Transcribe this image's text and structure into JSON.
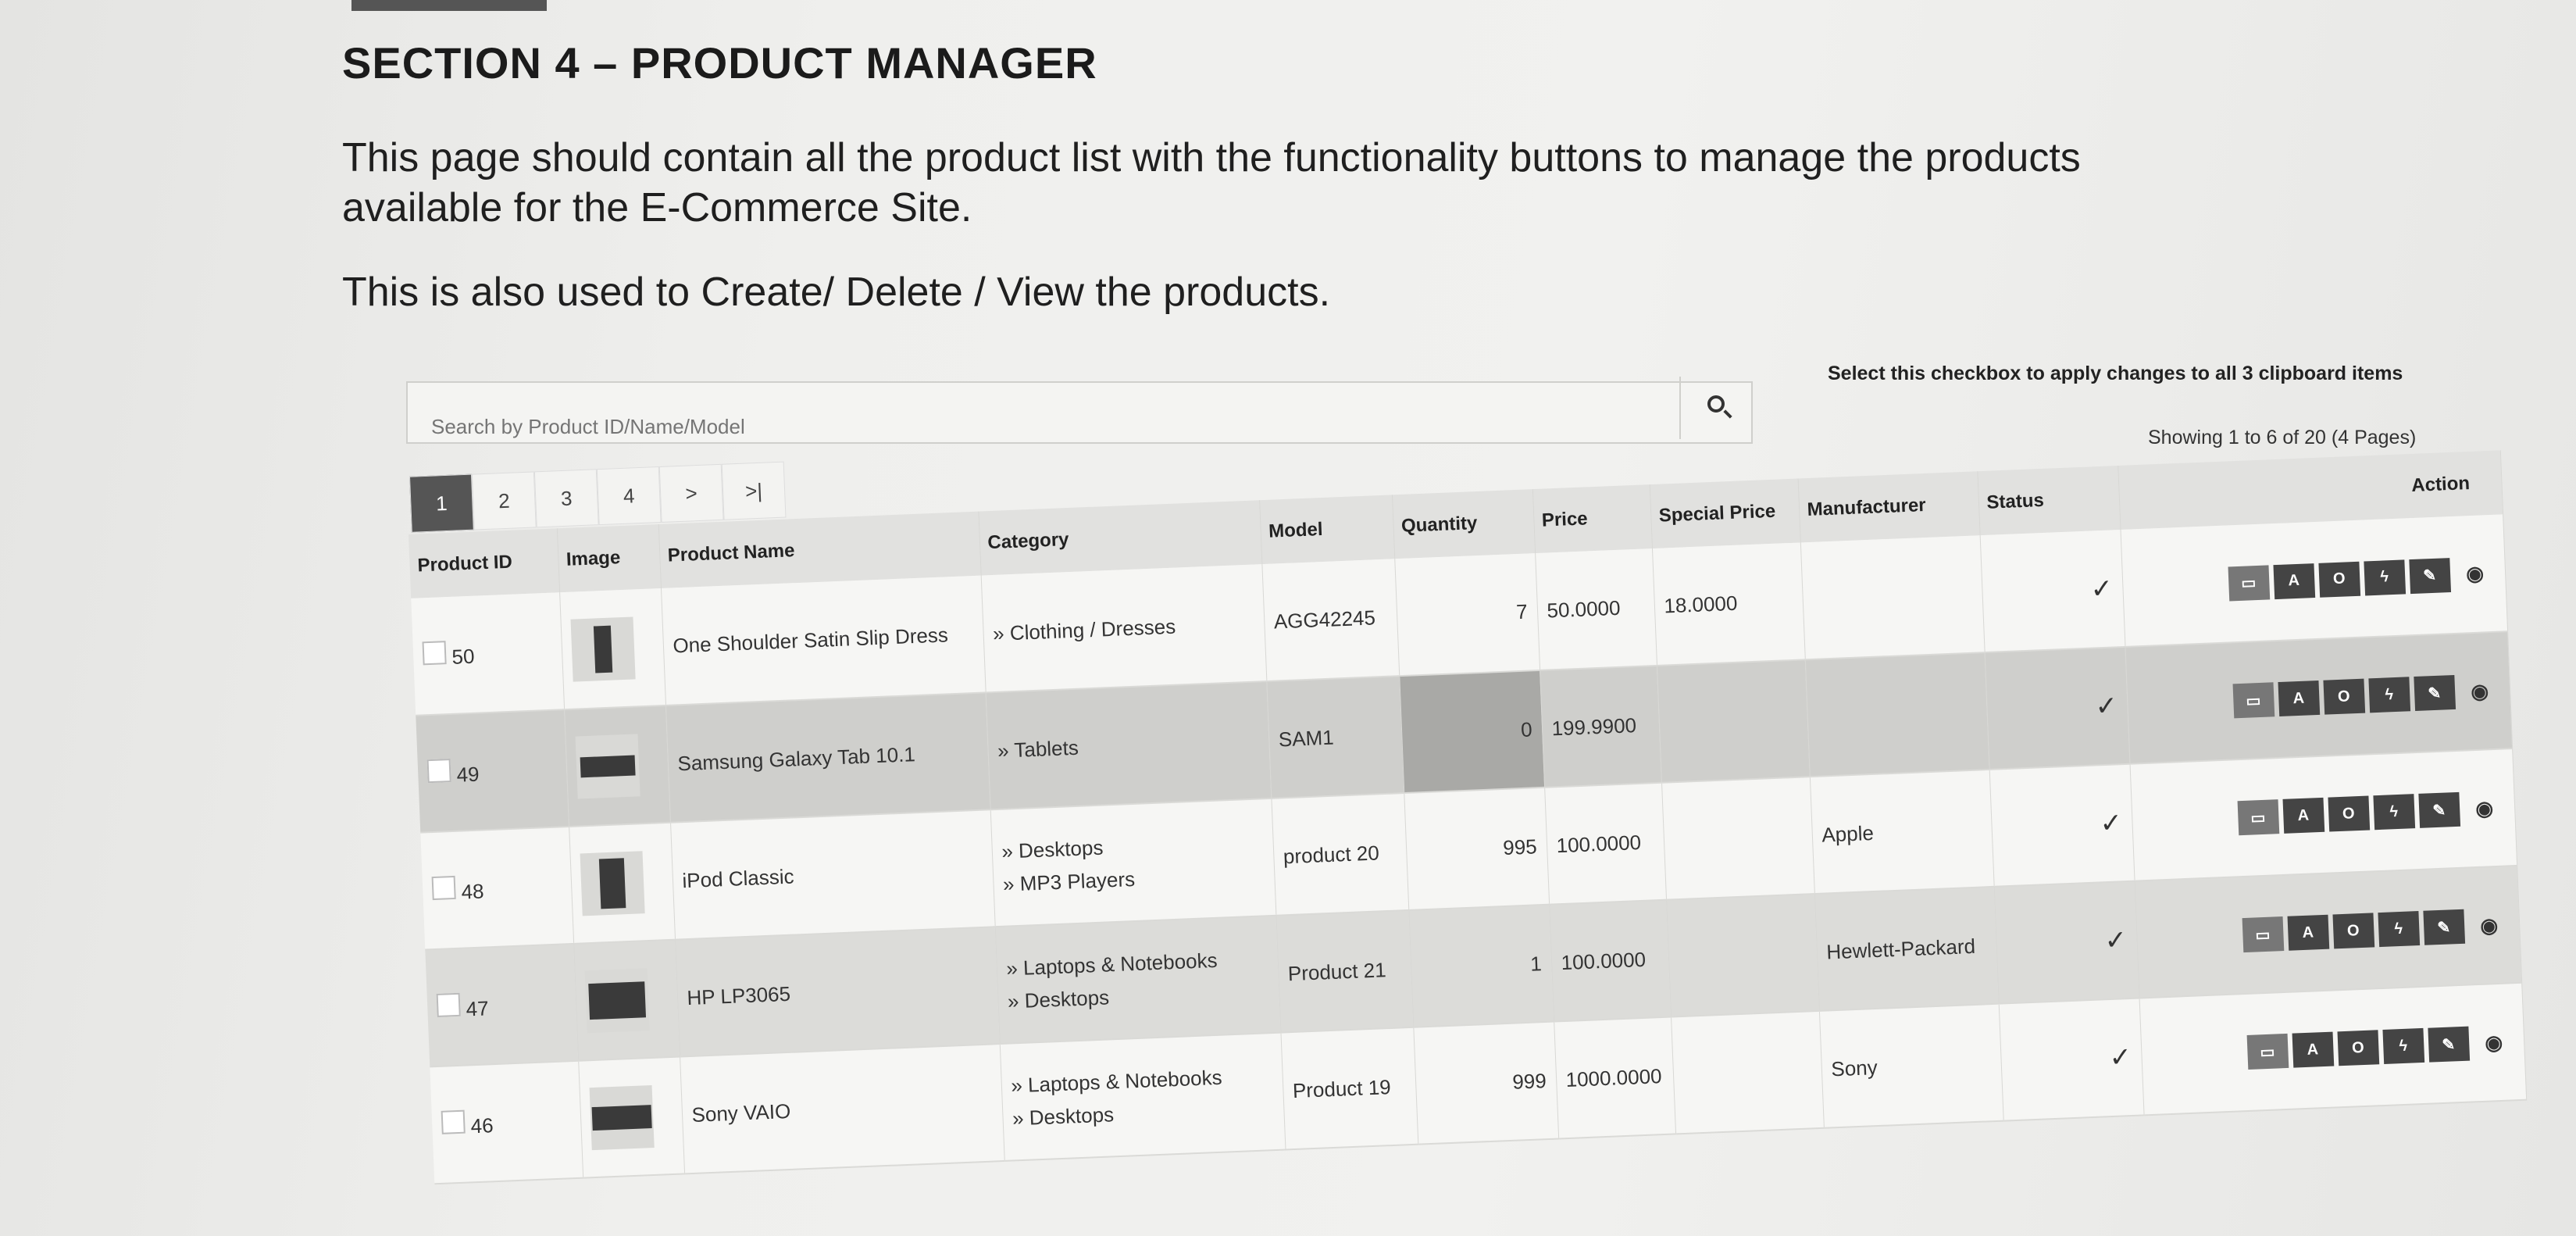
{
  "document": {
    "heading": "SECTION 4 – PRODUCT MANAGER",
    "para1": "This page should contain all the product list with the functionality buttons to manage the products available for the E-Commerce Site.",
    "para2": "This is also used to Create/ Delete / View the products."
  },
  "search": {
    "placeholder": "Search by Product ID/Name/Model",
    "icon": "search-icon"
  },
  "clipboard_note": "Select this checkbox to apply changes to all 3 clipboard items",
  "showing": "Showing 1 to 6 of 20 (4 Pages)",
  "pager": [
    "1",
    "2",
    "3",
    "4",
    ">",
    ">|"
  ],
  "columns": [
    "Product ID",
    "Image",
    "Product Name",
    "Category",
    "Model",
    "Quantity",
    "Price",
    "Special Price",
    "Manufacturer",
    "Status",
    "Action"
  ],
  "status_icon": "✓",
  "action_buttons": [
    "▭",
    "A",
    "O",
    "ϟ",
    "✎",
    "◉"
  ],
  "rows": [
    {
      "id": "50",
      "name": "One Shoulder Satin Slip Dress",
      "category": [
        "» Clothing / Dresses"
      ],
      "model": "AGG42245",
      "quantity": "7",
      "price": "50.0000",
      "special": "18.0000",
      "manufacturer": ""
    },
    {
      "id": "49",
      "name": "Samsung Galaxy Tab 10.1",
      "category": [
        "» Tablets"
      ],
      "model": "SAM1",
      "quantity": "0",
      "price": "199.9900",
      "special": "",
      "manufacturer": ""
    },
    {
      "id": "48",
      "name": "iPod Classic",
      "category": [
        "» Desktops",
        "» MP3 Players"
      ],
      "model": "product 20",
      "quantity": "995",
      "price": "100.0000",
      "special": "",
      "manufacturer": "Apple"
    },
    {
      "id": "47",
      "name": "HP LP3065",
      "category": [
        "» Laptops & Notebooks",
        "» Desktops"
      ],
      "model": "Product 21",
      "quantity": "1",
      "price": "100.0000",
      "special": "",
      "manufacturer": "Hewlett-Packard"
    },
    {
      "id": "46",
      "name": "Sony VAIO",
      "category": [
        "» Laptops & Notebooks",
        "» Desktops"
      ],
      "model": "Product 19",
      "quantity": "999",
      "price": "1000.0000",
      "special": "",
      "manufacturer": "Sony"
    }
  ]
}
